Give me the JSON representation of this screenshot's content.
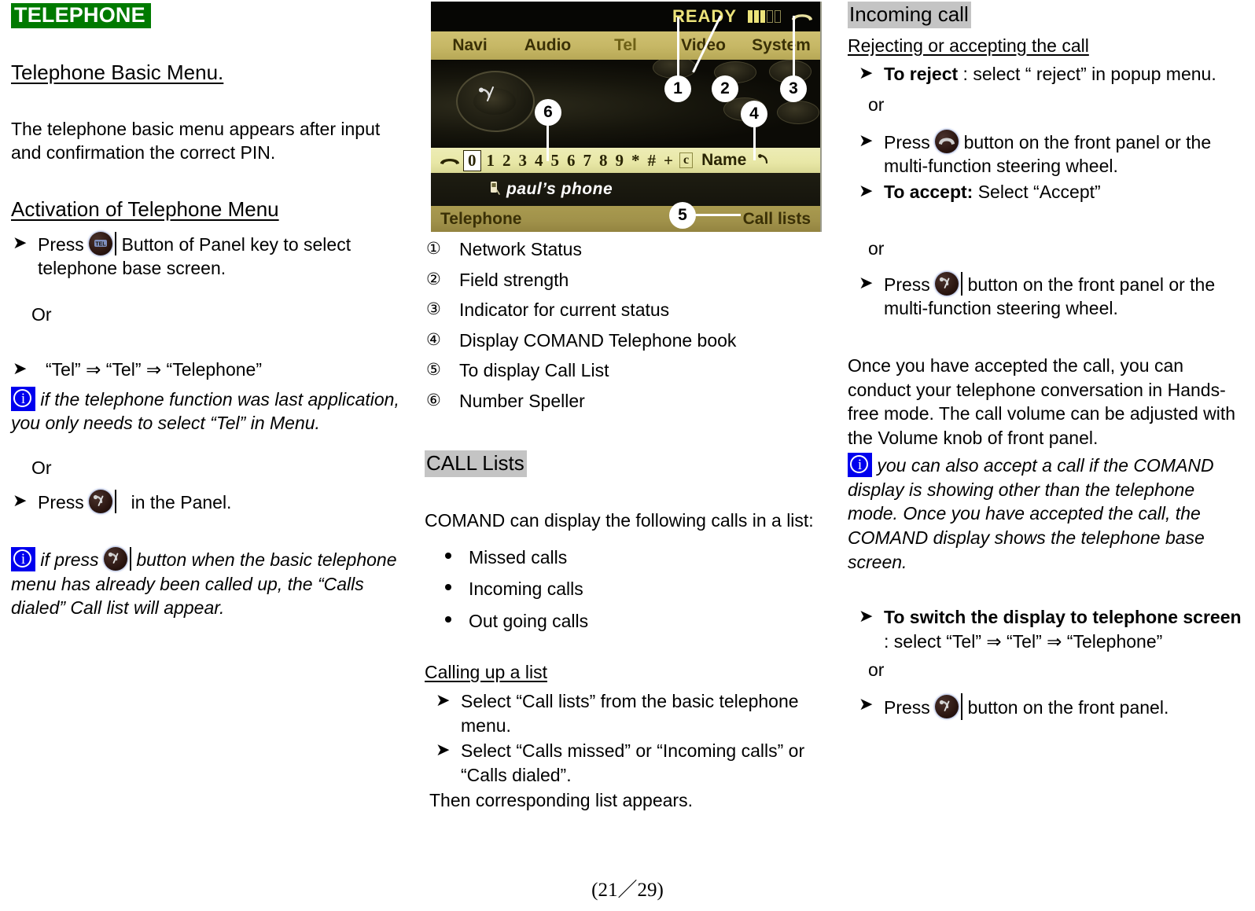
{
  "doc": {
    "title": "TELEPHONE",
    "footer": "(21／29)"
  },
  "left": {
    "section_heading": "Telephone Basic Menu.",
    "intro": "The telephone basic menu appears after input and confirmation the correct PIN.",
    "activation_heading": "Activation of Telephone Menu",
    "press_tel_pre": "Press",
    "press_tel_post": "Button of Panel key to select telephone base screen.",
    "or_1": "Or",
    "tel_path": "“Tel” ⇒ “Tel” ⇒ “Telephone”",
    "note_1": "if the telephone function was last application, you only needs to select “Tel” in Menu.",
    "or_2": "Or",
    "press_phone_pre": "Press",
    "press_phone_post": "in the Panel.",
    "note_2_pre": "if press",
    "note_2_post": "button when the basic telephone menu has already    been called up, the “Calls dialed” Call list will appear."
  },
  "comand": {
    "status_text": "READY",
    "signal_bars_filled": 3,
    "signal_bars_empty": 2,
    "menu_items": [
      "Navi",
      "Audio",
      "Tel",
      "Video",
      "System"
    ],
    "selected_menu": "Tel",
    "speller_keys": [
      "0",
      "1",
      "2",
      "3",
      "4",
      "5",
      "6",
      "7",
      "8",
      "9",
      "*",
      "#",
      "+"
    ],
    "speller_highlighted": "0",
    "speller_clear_key": "c",
    "speller_name_key": "Name",
    "entry_name": "paul’s phone",
    "bottom_left": "Telephone",
    "bottom_right": "Call lists",
    "callouts": [
      "1",
      "2",
      "3",
      "4",
      "5",
      "6"
    ]
  },
  "mid": {
    "legend": [
      {
        "num": "①",
        "label": "Network Status"
      },
      {
        "num": "②",
        "label": "Field strength"
      },
      {
        "num": "③",
        "label": "Indicator for current status"
      },
      {
        "num": "④",
        "label": "Display COMAND Telephone book"
      },
      {
        "num": "⑤",
        "label": "To display Call List"
      },
      {
        "num": "⑥",
        "label": "Number Speller"
      }
    ],
    "call_lists_heading": "CALL Lists",
    "call_lists_intro": "COMAND   can display the following calls in a list:",
    "call_list_types": [
      "Missed calls",
      "Incoming calls",
      "Out going calls"
    ],
    "calling_up_heading": "Calling up a list",
    "calling_up_steps": [
      "Select “Call lists” from the basic telephone menu.",
      "Select “Calls missed” or “Incoming calls” or “Calls dialed”."
    ],
    "calling_up_result": "Then corresponding list appears."
  },
  "right": {
    "incoming_heading": "Incoming call",
    "reject_accept_heading": "Rejecting or accepting the call",
    "to_reject_bold": "To reject",
    "to_reject_rest": ": select “ reject” in popup menu.",
    "or_1": "or",
    "press_hangup_pre": "Press",
    "press_hangup_post": "button on the front panel or the multi-function steering wheel.",
    "to_accept_bold": "To accept:",
    "to_accept_rest": "Select “Accept”",
    "or_2": "or",
    "press_phone_pre": "Press",
    "press_phone_post": "button on the front panel or the multi-function steering wheel.",
    "handsfree_para": "Once you have accepted the call, you can conduct your telephone conversation in Hands-free mode. The call volume can be adjusted with the Volume knob of front panel.",
    "note_para": "you can also accept a call if the COMAND display is showing other than the telephone mode. Once you have accepted the call, the COMAND display shows the telephone base screen.",
    "switch_bold": "To switch the display to telephone screen",
    "switch_rest": ": select   “Tel” ⇒ “Tel” ⇒ “Telephone”",
    "or_3": "or",
    "press_phone2_pre": "Press",
    "press_phone2_post": "button on the front panel."
  },
  "colors": {
    "title_bg": "#007a00",
    "highlight_bg": "#c4c4c4",
    "info_bg": "#0000ee",
    "comand_gold": "#c6b765",
    "comand_yellow": "#ece37a"
  }
}
